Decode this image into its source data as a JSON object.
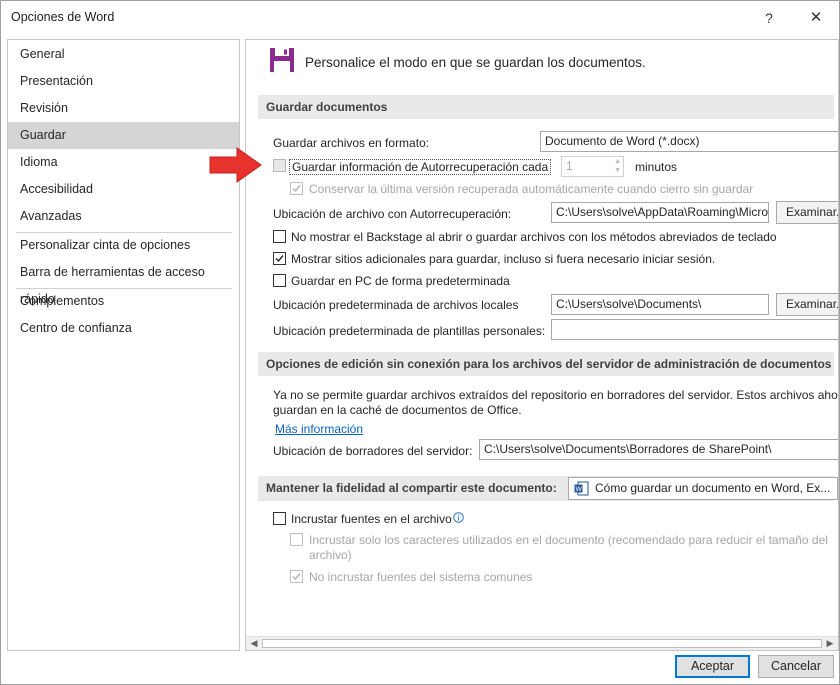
{
  "window": {
    "title": "Opciones de Word",
    "help": "?",
    "close": "✕"
  },
  "nav": {
    "items": [
      {
        "label": "General"
      },
      {
        "label": "Presentación"
      },
      {
        "label": "Revisión"
      },
      {
        "label": "Guardar",
        "selected": true
      },
      {
        "label": "Idioma"
      },
      {
        "label": "Accesibilidad"
      },
      {
        "label": "Avanzadas"
      },
      {
        "label": "Personalizar cinta de opciones"
      },
      {
        "label": "Barra de herramientas de acceso rápido"
      },
      {
        "label": "Complementos"
      },
      {
        "label": "Centro de confianza"
      }
    ]
  },
  "content": {
    "header": {
      "icon": "save-icon",
      "text": "Personalice el modo en que se guardan los documentos."
    },
    "save_docs": {
      "title": "Guardar documentos",
      "format_label": "Guardar archivos en formato:",
      "format_value": "Documento de Word (*.docx)",
      "autorecover_label": "Guardar información de Autorrecuperación cada",
      "autorecover_checked": false,
      "autorecover_minutes": "1",
      "minutes_label": "minutos",
      "keep_last_label": "Conservar la última versión recuperada automáticamente cuando cierro sin guardar",
      "keep_last_checked": true,
      "autorecover_path_label": "Ubicación de archivo con Autorrecuperación:",
      "autorecover_path_value": "C:\\Users\\solve\\AppData\\Roaming\\Microsoft\\Word\\",
      "browse_label": "Examinar...",
      "no_backstage_label": "No mostrar el Backstage al abrir o guardar archivos con los métodos abreviados de teclado",
      "no_backstage_checked": false,
      "show_more_label": "Mostrar sitios adicionales para guardar, incluso si fuera necesario iniciar sesión.",
      "show_more_checked": true,
      "save_pc_label": "Guardar en PC de forma predeterminada",
      "save_pc_checked": false,
      "local_path_label": "Ubicación predeterminada de archivos locales",
      "local_path_value": "C:\\Users\\solve\\Documents\\",
      "browse2_label": "Examinar...",
      "templates_label": "Ubicación predeterminada de plantillas personales:",
      "templates_value": ""
    },
    "offline": {
      "title": "Opciones de edición sin conexión para los archivos del servidor de administración de documentos",
      "text1": "Ya no se permite guardar archivos extraídos del repositorio en borradores del servidor. Estos archivos ahora se",
      "text2": "guardan en la caché de documentos de Office.",
      "more_info": "Más información",
      "drafts_label": "Ubicación de borradores del servidor:",
      "drafts_value": "C:\\Users\\solve\\Documents\\Borradores de SharePoint\\"
    },
    "fidelity": {
      "title": "Mantener la fidelidad al compartir este documento:",
      "doc_value": "Cómo guardar un documento en Word, Ex...",
      "embed_label": "Incrustar fuentes en el archivo",
      "embed_checked": false,
      "info_icon": "info-icon",
      "embed_used_label1": "Incrustar solo los caracteres utilizados en el documento (recomendado para reducir el tamaño del",
      "embed_used_label2": "archivo)",
      "embed_used_checked": false,
      "no_system_label": "No incrustar fuentes del sistema comunes",
      "no_system_checked": true
    }
  },
  "footer": {
    "ok_label": "Aceptar",
    "cancel_label": "Cancelar"
  },
  "annotation": {
    "arrow_color": "#e8322e"
  }
}
